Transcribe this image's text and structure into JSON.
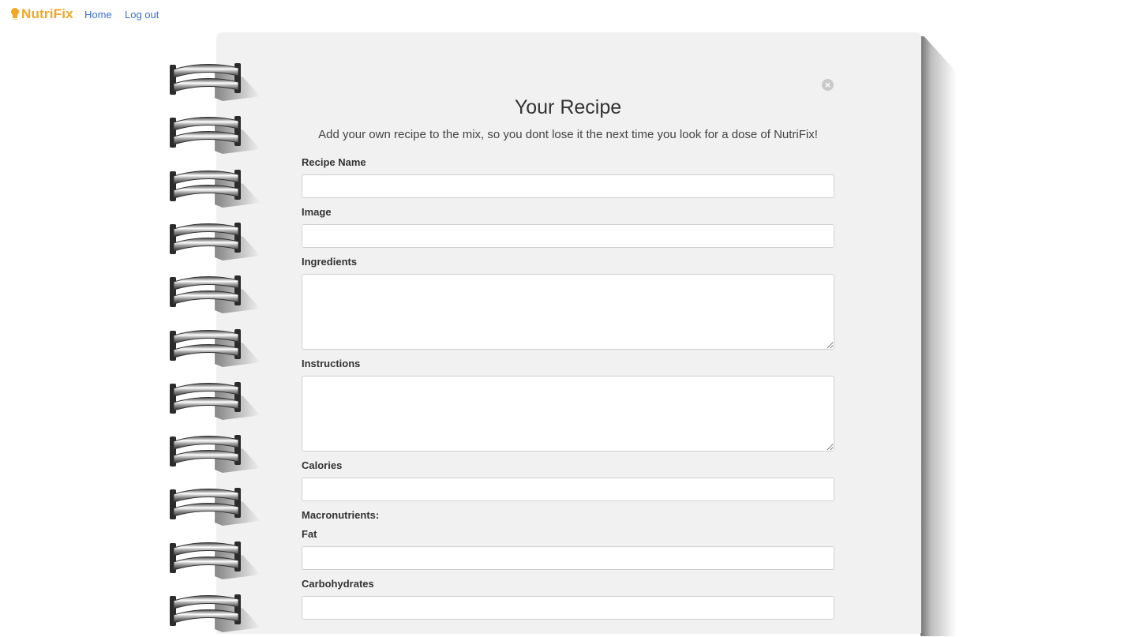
{
  "nav": {
    "brand": "NutriFix",
    "home": "Home",
    "logout": "Log out"
  },
  "colors": {
    "brand": "#f5a623",
    "link": "#3b6fd4",
    "paper": "#f1f1f1"
  },
  "icons": {
    "brand": "chef-hat-icon",
    "close": "close-x-icon",
    "binding": "spiral-ring-icon"
  },
  "form": {
    "close_symbol": "×",
    "title": "Your Recipe",
    "subtitle": "Add your own recipe to the mix, so you dont lose it the next time you look for a dose of NutriFix!",
    "recipe_name_label": "Recipe Name",
    "recipe_name_value": "",
    "image_label": "Image",
    "image_value": "",
    "ingredients_label": "Ingredients",
    "ingredients_value": "",
    "instructions_label": "Instructions",
    "instructions_value": "",
    "calories_label": "Calories",
    "calories_value": "",
    "macros_heading": "Macronutrients:",
    "fat_label": "Fat",
    "fat_value": "",
    "carbs_label": "Carbohydrates",
    "carbs_value": ""
  }
}
